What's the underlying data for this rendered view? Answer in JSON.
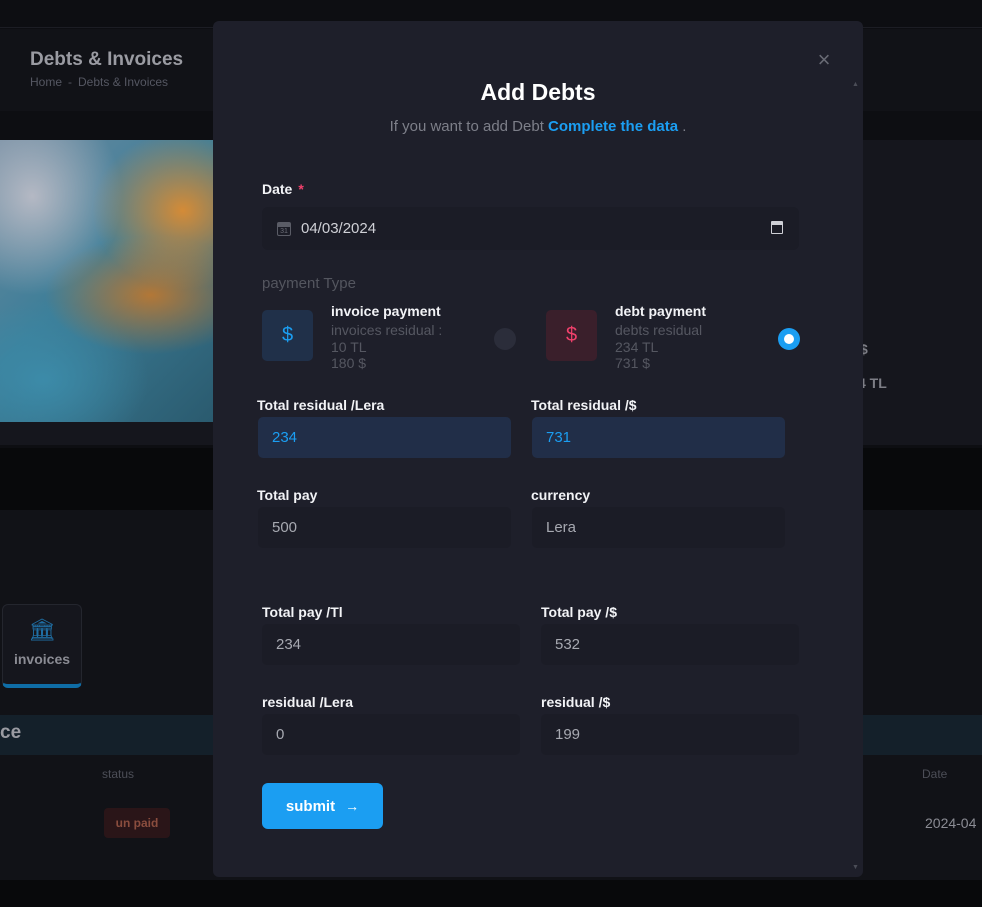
{
  "background": {
    "page_title": "Debts & Invoices",
    "breadcrumb": [
      "Home",
      "-",
      "Debts & Invoices"
    ],
    "right_values": [
      "$",
      "4 TL"
    ],
    "tile": {
      "icon": "bank-dollar-icon",
      "label": "invoices"
    },
    "table": {
      "title": "ce",
      "columns": {
        "status": "status",
        "date": "Date"
      },
      "rows": [
        {
          "status": "un paid",
          "date": "2024-04"
        }
      ]
    }
  },
  "modal": {
    "close_glyph": "×",
    "title": "Add Debts",
    "subtitle_prefix": "If you want to add Debt",
    "subtitle_link": "Complete the data",
    "subtitle_suffix": ".",
    "date": {
      "label": "Date",
      "required_mark": "*",
      "value": "04/03/2024",
      "icon_text": "31"
    },
    "payment_type": {
      "label": "payment Type",
      "options": [
        {
          "icon": "dollar-icon",
          "glyph": "$",
          "title": "invoice payment",
          "lines": [
            "invoices residual :",
            "10 TL",
            "180 $"
          ],
          "selected": false
        },
        {
          "icon": "dollar-icon",
          "glyph": "$",
          "title": "debt payment",
          "lines": [
            "debts residual",
            "234 TL",
            "731 $"
          ],
          "selected": true
        }
      ]
    },
    "total_residual_lera": {
      "label": "Total residual /Lera",
      "value": "234"
    },
    "total_residual_usd": {
      "label": "Total residual /$",
      "value": "731"
    },
    "total_pay": {
      "label": "Total pay",
      "value": "500"
    },
    "currency": {
      "label": "currency",
      "value": "Lera"
    },
    "total_pay_tl": {
      "label": "Total pay /Tl",
      "value": "234"
    },
    "total_pay_usd": {
      "label": "Total pay /$",
      "value": "532"
    },
    "residual_lera": {
      "label": "residual /Lera",
      "value": "0"
    },
    "residual_usd": {
      "label": "residual /$",
      "value": "199"
    },
    "submit": {
      "label": "submit",
      "arrow": "→"
    }
  },
  "colors": {
    "accent": "#1b9ef2",
    "danger": "#f1416c",
    "modal_bg": "#1e1f2a",
    "input_bg": "#1b1c26"
  }
}
